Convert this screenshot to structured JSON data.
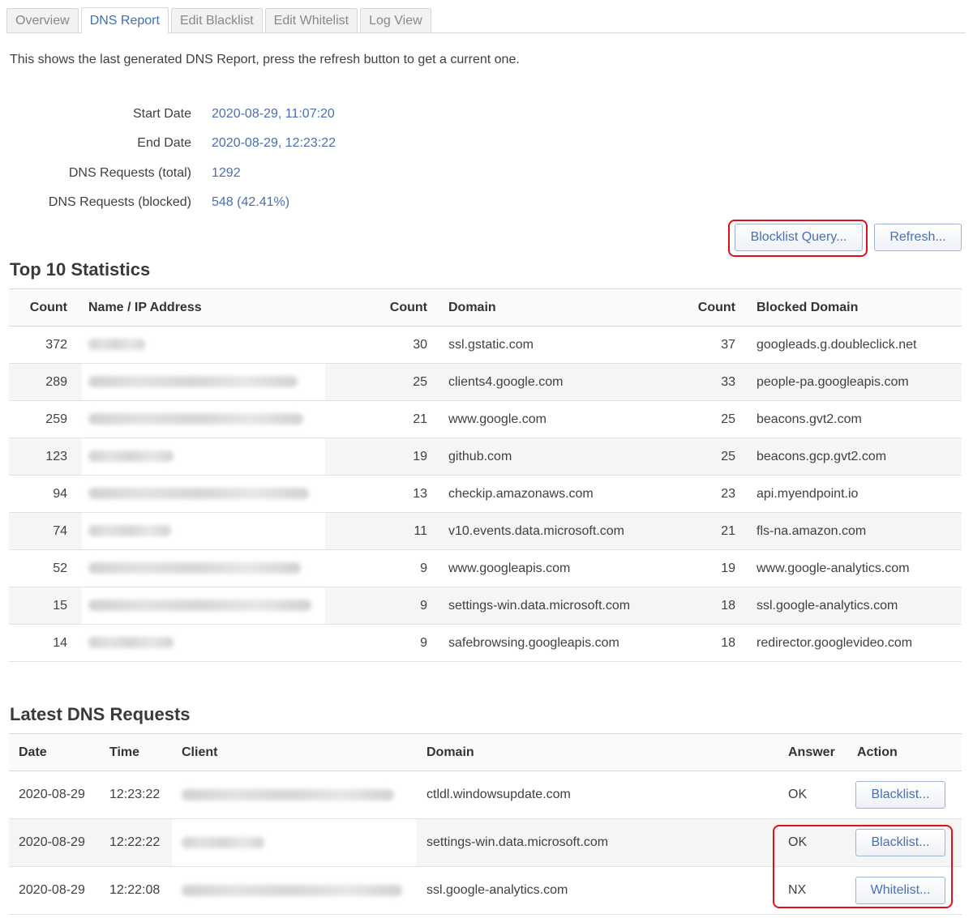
{
  "tabs": [
    {
      "label": "Overview",
      "active": false
    },
    {
      "label": "DNS Report",
      "active": true
    },
    {
      "label": "Edit Blacklist",
      "active": false
    },
    {
      "label": "Edit Whitelist",
      "active": false
    },
    {
      "label": "Log View",
      "active": false
    }
  ],
  "intro": "This shows the last generated DNS Report, press the refresh button to get a current one.",
  "info": [
    {
      "label": "Start Date",
      "value": "2020-08-29, 11:07:20"
    },
    {
      "label": "End Date",
      "value": "2020-08-29, 12:23:22"
    },
    {
      "label": "DNS Requests (total)",
      "value": "1292"
    },
    {
      "label": "DNS Requests (blocked)",
      "value": "548 (42.41%)"
    }
  ],
  "buttons": {
    "blocklist_query": "Blocklist Query...",
    "refresh": "Refresh..."
  },
  "top10": {
    "title": "Top 10 Statistics",
    "headers": [
      "Count",
      "Name / IP Address",
      "Count",
      "Domain",
      "Count",
      "Blocked Domain"
    ],
    "rows": [
      {
        "c1": "372",
        "c2": "30",
        "domain": "ssl.gstatic.com",
        "c3": "37",
        "blocked": "googleads.g.doubleclick.net"
      },
      {
        "c1": "289",
        "c2": "25",
        "domain": "clients4.google.com",
        "c3": "33",
        "blocked": "people-pa.googleapis.com"
      },
      {
        "c1": "259",
        "c2": "21",
        "domain": "www.google.com",
        "c3": "25",
        "blocked": "beacons.gvt2.com"
      },
      {
        "c1": "123",
        "c2": "19",
        "domain": "github.com",
        "c3": "25",
        "blocked": "beacons.gcp.gvt2.com"
      },
      {
        "c1": "94",
        "c2": "13",
        "domain": "checkip.amazonaws.com",
        "c3": "23",
        "blocked": "api.myendpoint.io"
      },
      {
        "c1": "74",
        "c2": "11",
        "domain": "v10.events.data.microsoft.com",
        "c3": "21",
        "blocked": "fls-na.amazon.com"
      },
      {
        "c1": "52",
        "c2": "9",
        "domain": "www.googleapis.com",
        "c3": "19",
        "blocked": "www.google-analytics.com"
      },
      {
        "c1": "15",
        "c2": "9",
        "domain": "settings-win.data.microsoft.com",
        "c3": "18",
        "blocked": "ssl.google-analytics.com"
      },
      {
        "c1": "14",
        "c2": "9",
        "domain": "safebrowsing.googleapis.com",
        "c3": "18",
        "blocked": "redirector.googlevideo.com"
      }
    ]
  },
  "latest": {
    "title": "Latest DNS Requests",
    "headers": [
      "Date",
      "Time",
      "Client",
      "Domain",
      "Answer",
      "Action"
    ],
    "rows": [
      {
        "date": "2020-08-29",
        "time": "12:23:22",
        "domain": "ctldl.windowsupdate.com",
        "answer": "OK",
        "action": "Blacklist..."
      },
      {
        "date": "2020-08-29",
        "time": "12:22:22",
        "domain": "settings-win.data.microsoft.com",
        "answer": "OK",
        "action": "Blacklist..."
      },
      {
        "date": "2020-08-29",
        "time": "12:22:08",
        "domain": "ssl.google-analytics.com",
        "answer": "NX",
        "action": "Whitelist..."
      }
    ]
  }
}
